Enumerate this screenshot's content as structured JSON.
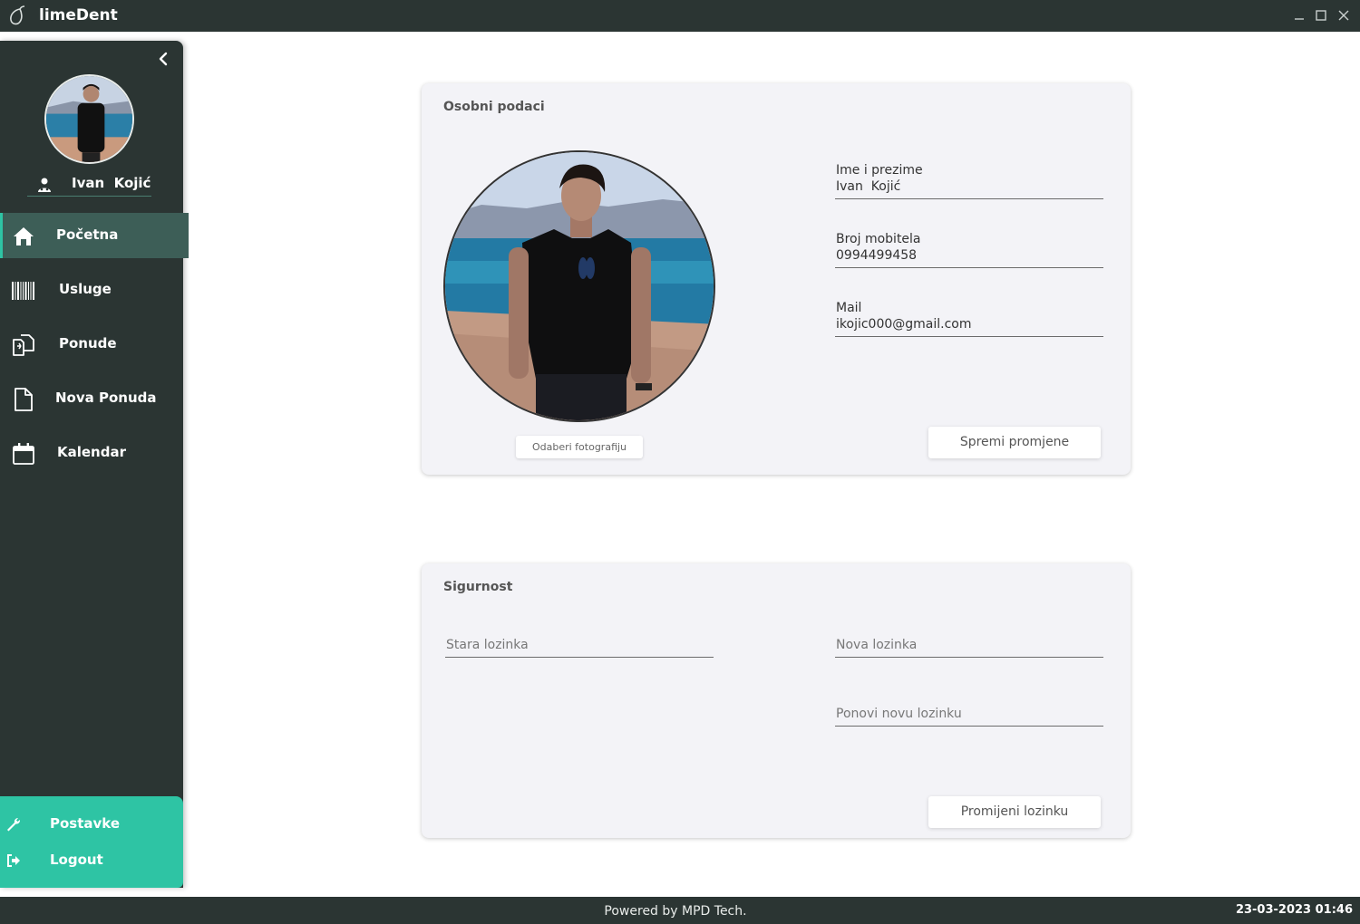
{
  "window": {
    "title": "limeDent",
    "minimize_icon": "minimize-icon",
    "maximize_icon": "maximize-icon",
    "close_icon": "close-icon"
  },
  "sidebar": {
    "user_name": "Ivan  Kojić",
    "items": [
      {
        "label": "Početna",
        "icon": "home-icon",
        "active": true
      },
      {
        "label": "Usluge",
        "icon": "barcode-icon",
        "active": false
      },
      {
        "label": "Ponude",
        "icon": "documents-icon",
        "active": false
      },
      {
        "label": "Nova Ponuda",
        "icon": "document-icon",
        "active": false
      },
      {
        "label": "Kalendar",
        "icon": "calendar-icon",
        "active": false
      }
    ],
    "bottom": [
      {
        "label": "Postavke",
        "icon": "wrench-icon"
      },
      {
        "label": "Logout",
        "icon": "logout-icon"
      }
    ]
  },
  "personal": {
    "title": "Osobni podaci",
    "choose_photo": "Odaberi fotografiju",
    "fields": [
      {
        "label": "Ime i prezime",
        "value": "Ivan  Kojić"
      },
      {
        "label": "Broj mobitela",
        "value": "0994499458"
      },
      {
        "label": "Mail",
        "value": "ikojic000@gmail.com"
      }
    ],
    "save_button": "Spremi promjene"
  },
  "security": {
    "title": "Sigurnost",
    "old_password_placeholder": "Stara lozinka",
    "new_password_placeholder": "Nova lozinka",
    "repeat_password_placeholder": "Ponovi novu lozinku",
    "change_button": "Promijeni lozinku"
  },
  "footer": {
    "credit": "Powered by MPD Tech.",
    "clock": "23-03-2023 01:46"
  },
  "colors": {
    "dark": "#2b3533",
    "accent": "#2ec4a4",
    "active_nav": "#3d5e57",
    "card_bg": "#f3f3f7"
  }
}
